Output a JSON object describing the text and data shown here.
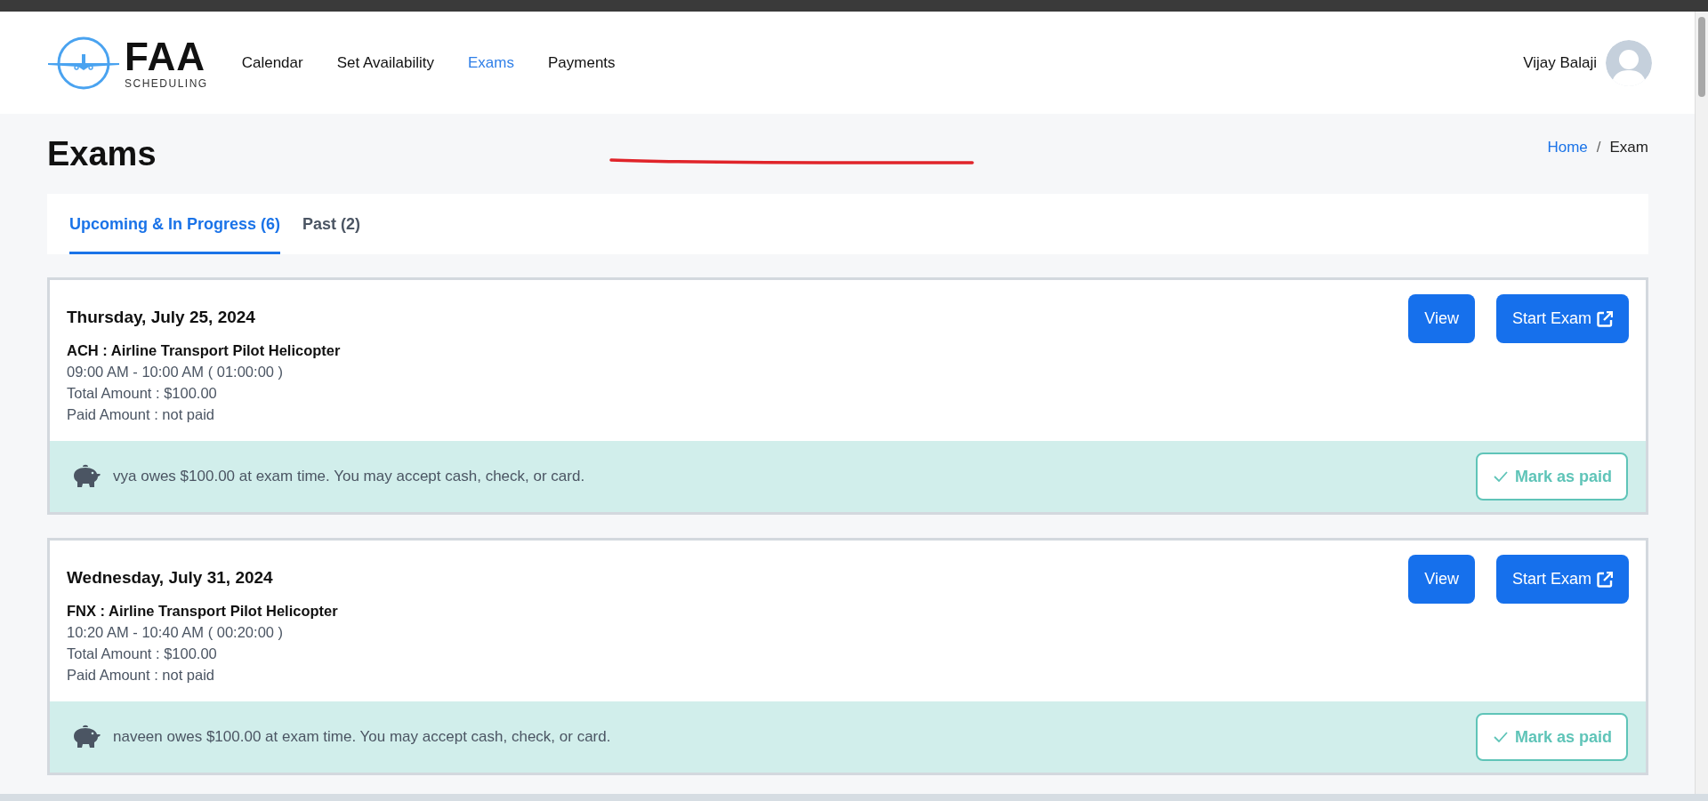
{
  "brand": {
    "name": "FAA",
    "tagline": "SCHEDULING"
  },
  "nav": [
    {
      "label": "Calendar",
      "selected": false
    },
    {
      "label": "Set Availability",
      "selected": false
    },
    {
      "label": "Exams",
      "selected": true
    },
    {
      "label": "Payments",
      "selected": false
    }
  ],
  "user": {
    "name": "Vijay Balaji"
  },
  "page_title": "Exams",
  "breadcrumb": [
    {
      "label": "Home",
      "kind": "link"
    },
    {
      "label": "/",
      "kind": "separator"
    },
    {
      "label": "Exam",
      "kind": "current"
    }
  ],
  "tabs": [
    {
      "label": "Upcoming & In Progress (6)",
      "selected": true
    },
    {
      "label": "Past (2)",
      "selected": false
    }
  ],
  "exams": [
    {
      "date": "Thursday, July 25, 2024",
      "title": "ACH : Airline Transport Pilot Helicopter",
      "time": "09:00 AM - 10:00 AM ( 01:00:00 )",
      "total": "Total Amount : $100.00",
      "paid": "Paid Amount : not paid",
      "view_button": "View",
      "start_button": "Start Exam",
      "note": "vya owes $100.00 at exam time. You may accept cash, check, or card.",
      "mark_button": "Mark as paid"
    },
    {
      "date": "Wednesday, July 31, 2024",
      "title": "FNX : Airline Transport Pilot Helicopter",
      "time": "10:20 AM - 10:40 AM ( 00:20:00 )",
      "total": "Total Amount : $100.00",
      "paid": "Paid Amount : not paid",
      "view_button": "View",
      "start_button": "Start Exam",
      "note": "naveen owes $100.00 at exam time. You may accept cash, check, or card.",
      "mark_button": "Mark as paid"
    }
  ]
}
